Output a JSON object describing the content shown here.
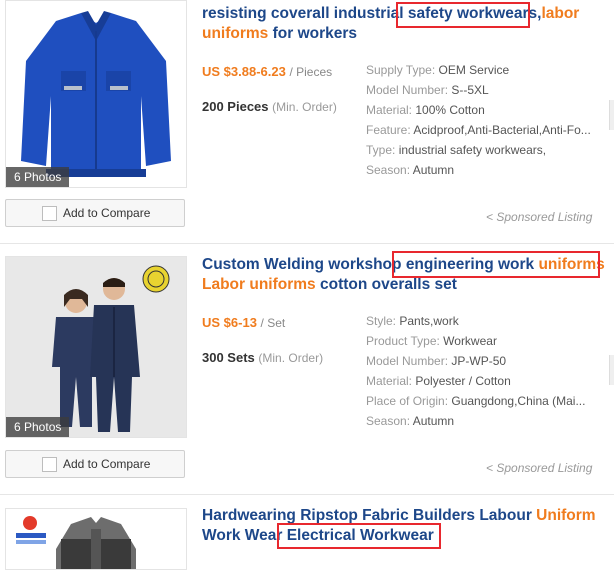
{
  "listings": [
    {
      "title_parts": [
        "resisting coverall industrial ",
        "safety workwears",
        ",",
        "labor uniforms",
        " for workers"
      ],
      "price": "US $3.88-6.23",
      "price_unit": "/ Pieces",
      "moq": "200 Pieces",
      "moq_label": "(Min. Order)",
      "photos": "6 Photos",
      "compare": "Add to Compare",
      "sponsored": "< Sponsored Listing",
      "attributes": [
        {
          "k": "Supply Type: ",
          "v": "OEM Service"
        },
        {
          "k": "Model Number: ",
          "v": "S--5XL"
        },
        {
          "k": "Material: ",
          "v": "100% Cotton"
        },
        {
          "k": "Feature: ",
          "v": "Acidproof,Anti-Bacterial,Anti-Fo..."
        },
        {
          "k": "Type: ",
          "v": "industrial safety workwears,"
        },
        {
          "k": "Season: ",
          "v": "Autumn"
        }
      ]
    },
    {
      "title_line1a": "Custom Welding workshop ",
      "title_line1b": "engineering work ",
      "title_line1c": "uniforms",
      "title_line2a": "Labor uniforms",
      "title_line2b": " cotton overalls set",
      "price": "US $6-13",
      "price_unit": "/ Set",
      "moq": "300 Sets",
      "moq_label": "(Min. Order)",
      "photos": "6 Photos",
      "compare": "Add to Compare",
      "sponsored": "< Sponsored Listing",
      "attributes": [
        {
          "k": "Style: ",
          "v": "Pants,work"
        },
        {
          "k": "Product Type: ",
          "v": "Workwear"
        },
        {
          "k": "Model Number: ",
          "v": "JP-WP-50"
        },
        {
          "k": "Material: ",
          "v": "Polyester / Cotton"
        },
        {
          "k": "Place of Origin: ",
          "v": "Guangdong,China (Mai..."
        },
        {
          "k": "Season: ",
          "v": "Autumn"
        }
      ]
    },
    {
      "title_line1a": "Hardwearing Ripstop Fabric Builders Labour ",
      "title_line1b": "Uniform",
      "title_line2a": "Work Wear ",
      "title_line2b": "Electrical Workwear"
    }
  ],
  "colors": {
    "title": "#1d4789",
    "accent": "#f07c1e",
    "highlight_box": "#e8282e"
  }
}
